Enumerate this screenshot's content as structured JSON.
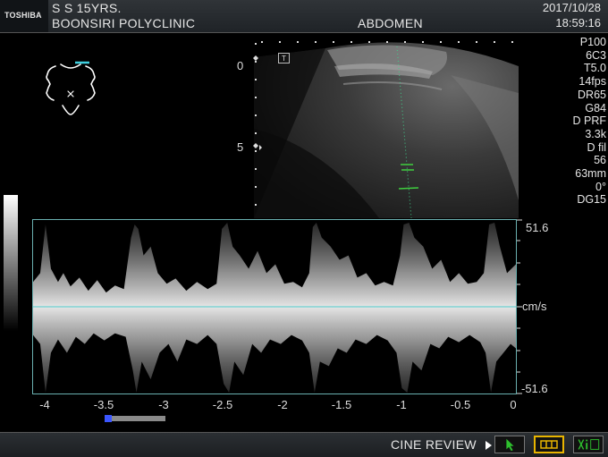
{
  "header": {
    "brand": "TOSHIBA",
    "patient": "S S 15YRS.",
    "clinic": "BOONSIRI POLYCLINIC",
    "exam": "ABDOMEN",
    "date": "2017/10/28",
    "time": "18:59:16"
  },
  "params": [
    "P100",
    "6C3",
    "T5.0",
    "14fps",
    "DR65",
    "G84",
    "D PRF",
    "3.3k",
    "D fil",
    "56",
    "63mm",
    "0°",
    "DG15"
  ],
  "bmode": {
    "depth_labels": [
      "0",
      "5"
    ],
    "t_marker": "T"
  },
  "doppler": {
    "max_label": "51.6",
    "unit_label": "cm/s",
    "min_label": "-51.6",
    "time_labels": [
      "-4",
      "-3.5",
      "-3",
      "-2.5",
      "-2",
      "-1.5",
      "-1",
      "-0.5",
      "0"
    ]
  },
  "footer": {
    "cine_label": "CINE REVIEW"
  },
  "colors": {
    "baseline": "#7fd3d3",
    "frame": "#6ab0b0",
    "scroll_thumb": "#3b56ff",
    "cine_button_border": "#e8b400",
    "arrow_green": "#2ec02e"
  }
}
